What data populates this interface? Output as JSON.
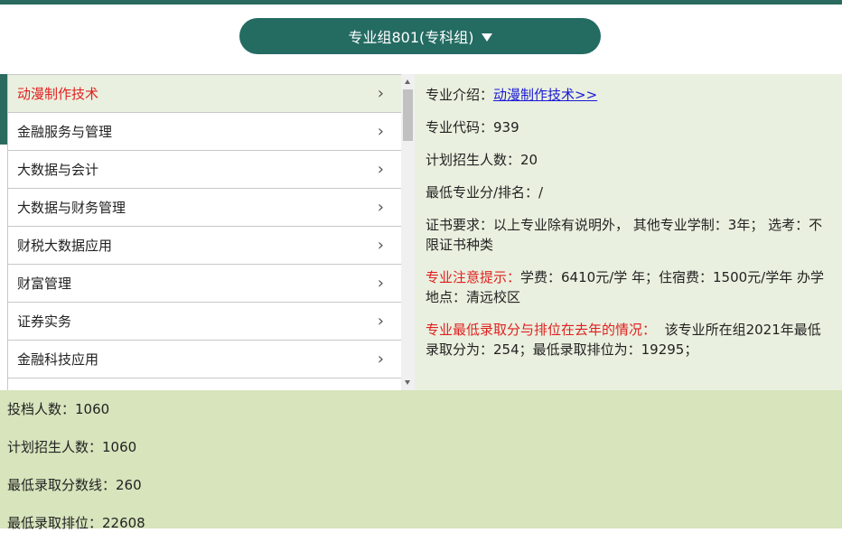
{
  "group_selector": {
    "label": "专业组801(专科组)",
    "icon": "caret-down-icon"
  },
  "majors": [
    "动漫制作技术",
    "金融服务与管理",
    "大数据与会计",
    "大数据与财务管理",
    "财税大数据应用",
    "财富管理",
    "证券实务",
    "金融科技应用"
  ],
  "chevron": "›",
  "detail": {
    "intro_label": "专业介绍：",
    "intro_link": "动漫制作技术>>",
    "code": "专业代码：939",
    "plan": "计划招生人数：20",
    "min_score_rank": "最低专业分/排名：/",
    "cert": "证书要求：以上专业除有说明外， 其他专业学制：3年； 选考：不限证书种类",
    "notice_label": "专业注意提示：",
    "notice_text": "学费：6410元/学 年；住宿费：1500元/学年 办学地点：清远校区",
    "history_label": "专业最低录取分与排位在去年的情况：",
    "history_text": "该专业所在组2021年最低录取分为：254；最低录取排位为：19295；"
  },
  "summary": {
    "applicants": "投档人数：1060",
    "plan": "计划招生人数：1060",
    "min_score": "最低录取分数线：260",
    "min_rank": "最低录取排位：22608"
  },
  "colors": {
    "primary": "#246b62",
    "active_text": "#e02020",
    "detail_bg": "#eaf0df",
    "summary_bg": "#d7e4bc",
    "link": "#1a1ad6"
  }
}
